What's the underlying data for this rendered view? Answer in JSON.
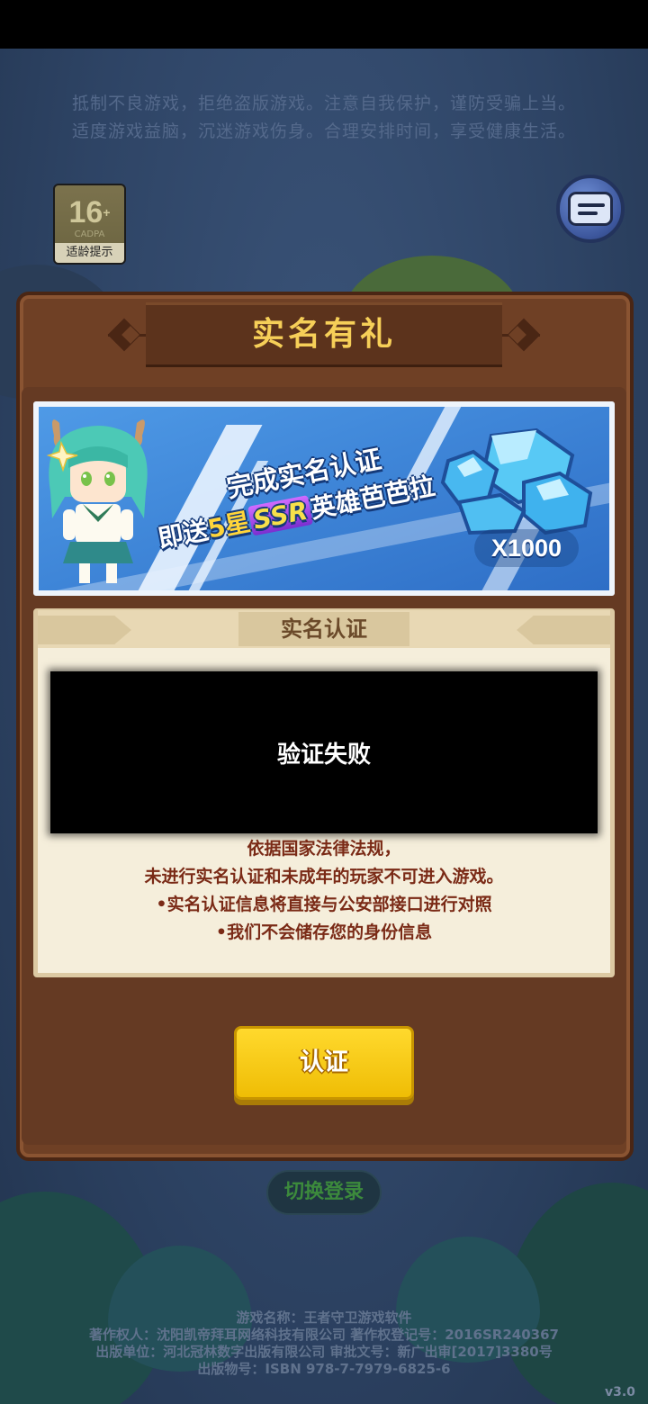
{
  "health_notice": {
    "line1": "抵制不良游戏，拒绝盗版游戏。注意自我保护，谨防受骗上当。",
    "line2": "适度游戏益脑，沉迷游戏伤身。合理安排时间，享受健康生活。"
  },
  "age_rating": {
    "number": "16",
    "plus": "+",
    "org": "CADPA",
    "label": "适龄提示"
  },
  "dialog": {
    "title": "实名有礼",
    "banner": {
      "line1": "完成实名认证",
      "line2_prefix": "即送",
      "stars": "5星",
      "rarity": "SSR",
      "line2_suffix": "英雄芭芭拉",
      "reward": "X1000"
    },
    "section_title": "实名认证",
    "error_message": "验证失败",
    "legal": [
      "依据国家法律法规，",
      "未进行实名认证和未成年的玩家不可进入游戏。",
      "•实名认证信息将直接与公安部接口进行对照",
      "•我们不会储存您的身份信息"
    ],
    "confirm_label": "认证"
  },
  "switch_login_label": "切换登录",
  "footer": [
    "游戏名称：王者守卫游戏软件",
    "著作权人：沈阳凯帝拜耳网络科技有限公司 著作权登记号：2016SR240367",
    "出版单位：河北冠林数字出版有限公司 审批文号：新广出审[2017]3380号",
    "出版物号：ISBN 978-7-7979-6825-6"
  ],
  "version": "v3.0",
  "colors": {
    "title_gold": "#f6cf58",
    "panel_brown": "#6f4025",
    "button_yellow": "#ffd92d",
    "legal_red": "#7a2a16"
  }
}
